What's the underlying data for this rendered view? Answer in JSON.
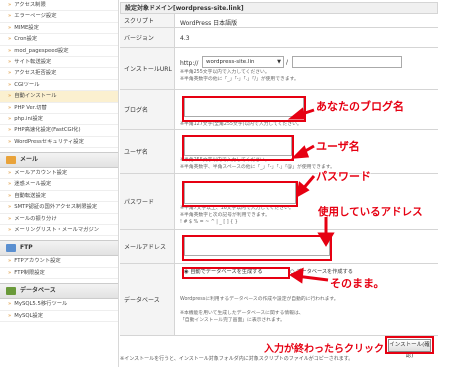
{
  "sidebar": {
    "items_top": [
      "アクセス制限",
      "エラーページ設定",
      "MIME設定",
      "Cron設定",
      "mod_pagespeed設定",
      "サイト転送設定",
      "アクセス拒否設定",
      "CGIツール",
      "自動インストール",
      "PHP Ver.切替",
      "php.ini設定",
      "PHP高速化設定(FastCGI化)",
      "WordPressセキュリティ設定"
    ],
    "active_index": 8,
    "mail_head": "メール",
    "items_mail": [
      "メールアカウント設定",
      "迷惑メール設定",
      "自動転送設定",
      "SMTP認証の国外アクセス制限設定",
      "メールの振り分け",
      "メーリングリスト・メールマガジン"
    ],
    "ftp_head": "FTP",
    "items_ftp": [
      "FTPアカウント設定",
      "FTP制限設定"
    ],
    "db_head": "データベース",
    "items_db": [
      "MySQL5.5移行ツール",
      "MySQL設定"
    ]
  },
  "form": {
    "header": "設定対象ドメイン[wordpress-site.link]",
    "script_label": "スクリプト",
    "script_value": "WordPress 日本語版",
    "version_label": "バージョン",
    "version_value": "4.3",
    "url_label": "インストールURL",
    "url_scheme": "http://",
    "url_domain": "wordpress-site.lin",
    "url_slash": "/",
    "url_note1": "※半角255文字以内で入力してください。",
    "url_note2": "※半角英数字の他に「_」「-」「.」「/」が使用できます。",
    "blog_label": "ブログ名",
    "blog_note": "※半角127文字(全角255文字)以内で入力してください。",
    "user_label": "ユーザ名",
    "user_note1": "※半角255文字以内で入力してください。",
    "user_note2": "※半角英数字、半角スペースの他に「_」「-」「.」「@」が使用できます。",
    "pass_label": "パスワード",
    "pass_note1": "※半角7文字以上、16文字以内で入力してください。",
    "pass_note2": "※半角英数字と次の記号が利用できます。",
    "pass_note3": "! # $ % = ~ ^ | _ [ ] { }",
    "mail_label": "メールアドレス",
    "db_label": "データベース",
    "db_option": "自動でデータベースを生成する",
    "db_option2": "データベースを作成する",
    "db_note1": "Wordpressに利用するデータベースの作成や設定が自動的に行われます。",
    "db_note2": "※本機能を用いて生成したデータベースに関する情報は、",
    "db_note3": "「自動インストール完了画面」に表示されます。",
    "install_button": "インストール(確認)",
    "bottom_note": "※インストールを行うと、インストール対象フォルダ内に対象スクリプトのファイルがコピーされます。"
  },
  "annotations": {
    "blog": "あなたのブログ名",
    "user": "ユーザ名",
    "pass": "パスワード",
    "mail": "使用しているアドレス",
    "db": "そのまま。",
    "install": "入力が終わったらクリック"
  },
  "colors": {
    "accent_red": "#e60012",
    "sidebar_bullet": "#d88a24"
  }
}
